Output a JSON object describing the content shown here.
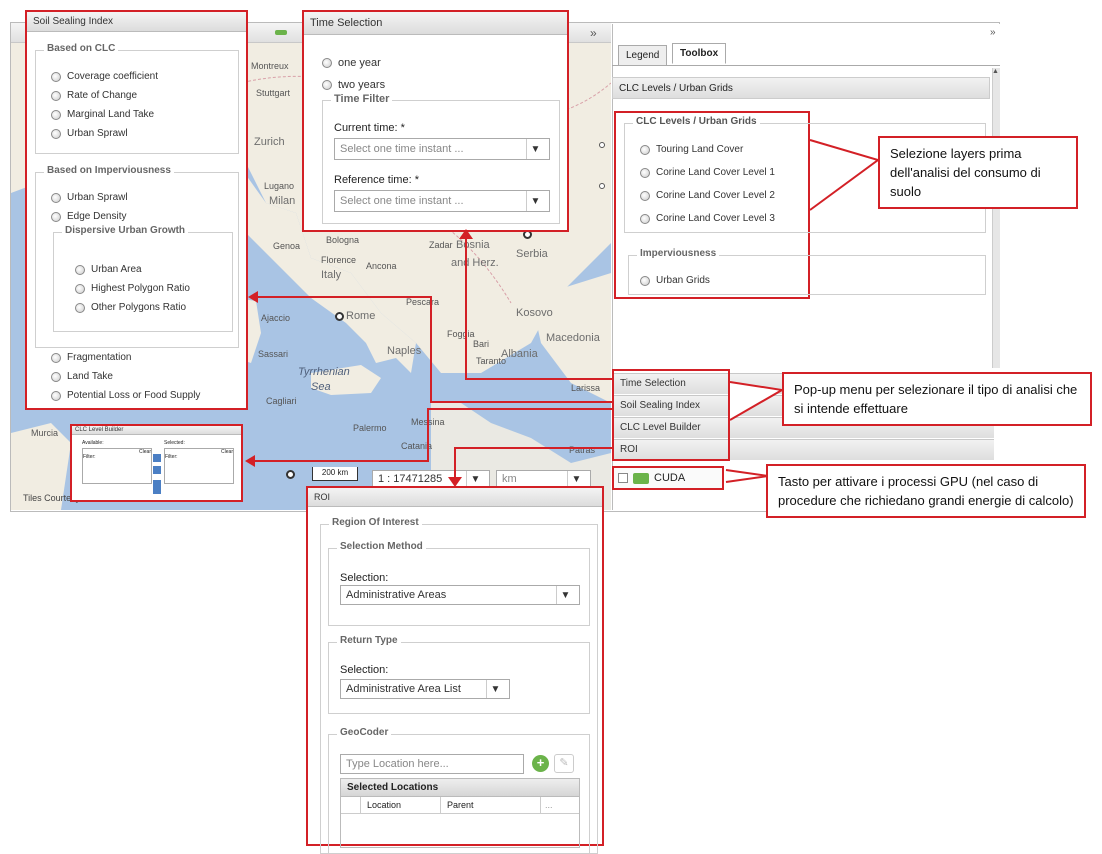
{
  "map": {
    "labels": [
      "Montreux",
      "Stuttgart",
      "Zurich",
      "Milan",
      "Lugano",
      "Bologna",
      "Genoa",
      "Florence",
      "Ancona",
      "Italy",
      "Zadar",
      "Bosnia",
      "and Herz.",
      "Serbia",
      "Kosovo",
      "Macedonia",
      "Albania",
      "Rome",
      "Naples",
      "Foggia",
      "Bari",
      "Taranto",
      "Pescara",
      "Ajaccio",
      "Sassari",
      "Tyrrhenian",
      "Sea",
      "Cagliari",
      "Palermo",
      "Messina",
      "Catania",
      "Larissa",
      "Patras",
      "Murcia",
      "Tiles Courtesy"
    ],
    "scale_label": "200 km",
    "scale_ratio": "1 : 17471285",
    "units": "km",
    "expand_glyph": "»"
  },
  "soil_sealing": {
    "title": "Soil Sealing Index",
    "group1_title": "Based on CLC",
    "group1_items": [
      "Coverage coefficient",
      "Rate of Change",
      "Marginal Land Take",
      "Urban Sprawl"
    ],
    "group2_title": "Based on Imperviousness",
    "group2_items": [
      "Urban Sprawl",
      "Edge Density"
    ],
    "dispersive_title": "Dispersive Urban Growth",
    "dispersive_items": [
      "Urban Area",
      "Highest Polygon Ratio",
      "Other Polygons Ratio"
    ],
    "bottom_items": [
      "Fragmentation",
      "Land Take",
      "Potential Loss or Food Supply"
    ]
  },
  "time_selection": {
    "title": "Time Selection",
    "options": [
      "one year",
      "two years"
    ],
    "filter_title": "Time Filter",
    "current_label": "Current time: *",
    "reference_label": "Reference time: *",
    "placeholder": "Select one time instant ..."
  },
  "toolbox": {
    "tabs": [
      "Legend",
      "Toolbox"
    ],
    "section_title": "CLC Levels / Urban Grids",
    "group_title": "CLC Levels / Urban Grids",
    "items": [
      "Touring Land Cover",
      "Corine Land Cover Level 1",
      "Corine Land Cover Level 2",
      "Corine Land Cover Level 3"
    ],
    "imperv_title": "Imperviousness",
    "imperv_items": [
      "Urban Grids"
    ],
    "accordion": [
      "Time Selection",
      "Soil Sealing Index",
      "CLC Level Builder",
      "ROI"
    ],
    "cuda_label": "CUDA"
  },
  "clc_builder": {
    "title": "CLC Level Builder",
    "available": "Available:",
    "selected": "Selected:",
    "filter": "Filter:",
    "clear": "Clear"
  },
  "roi": {
    "title": "ROI",
    "region_title": "Region Of Interest",
    "selection_method": "Selection Method",
    "selection_label": "Selection:",
    "selection_value": "Administrative Areas",
    "return_type": "Return Type",
    "return_label": "Selection:",
    "return_value": "Administrative Area List",
    "geocoder": "GeoCoder",
    "geocoder_placeholder": "Type Location here...",
    "selected_locations": "Selected Locations",
    "col_location": "Location",
    "col_parent": "Parent",
    "col_more": "..."
  },
  "callouts": {
    "layers": "Selezione layers prima dell'analisi del consumo di suolo",
    "popup": "Pop-up menu per selezionare il tipo di analisi che si intende effettuare",
    "gpu": "Tasto per attivare i processi GPU (nel caso di procedure che richiedano grandi energie di calcolo)"
  },
  "colors": {
    "sea": "#a9c4e4",
    "land": "#f2efe6",
    "accent_red": "#d32026",
    "green": "#6bb34a"
  }
}
